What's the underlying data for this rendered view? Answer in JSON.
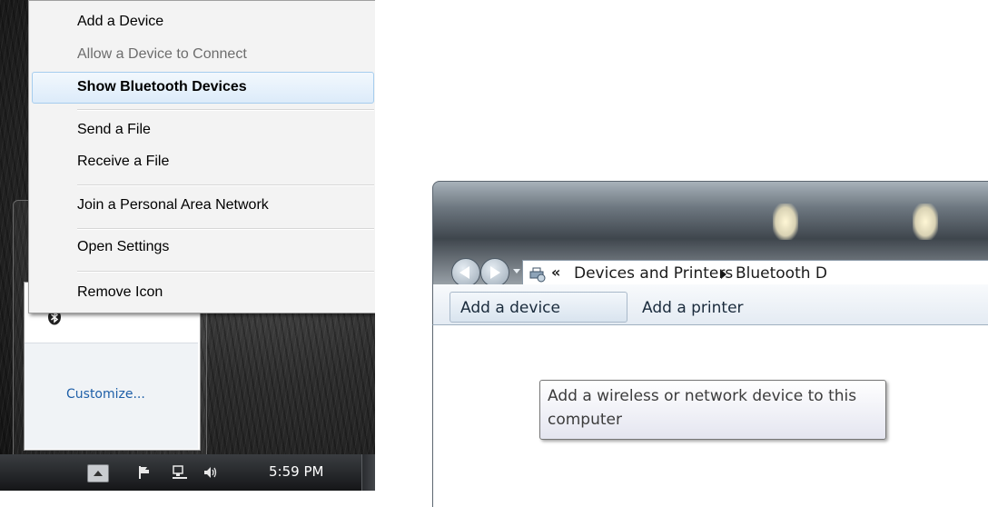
{
  "bluetooth_menu": {
    "items": [
      {
        "label": "Add a Device",
        "state": "normal"
      },
      {
        "label": "Allow a Device to Connect",
        "state": "disabled"
      },
      {
        "label": "Show Bluetooth Devices",
        "state": "highlighted"
      },
      {
        "label": "Send a File",
        "state": "normal"
      },
      {
        "label": "Receive a File",
        "state": "normal"
      },
      {
        "label": "Join a Personal Area Network",
        "state": "normal"
      },
      {
        "label": "Open Settings",
        "state": "normal"
      },
      {
        "label": "Remove Icon",
        "state": "normal"
      }
    ]
  },
  "tray_flyout": {
    "icon": "bluetooth-icon",
    "customize_label": "Customize..."
  },
  "taskbar": {
    "clock": "5:59 PM",
    "icons": [
      "show-hidden-icons-icon",
      "action-center-flag-icon",
      "network-icon",
      "volume-icon"
    ]
  },
  "explorer": {
    "breadcrumb": {
      "overflow": "«",
      "items": [
        "Devices and Printers",
        "Bluetooth D"
      ]
    },
    "toolbar": {
      "add_device_label": "Add a device",
      "add_printer_label": "Add a printer"
    },
    "tooltip": "Add a wireless or network device to this computer"
  },
  "colors": {
    "menu_highlight": "#dcebfa",
    "menu_highlight_border": "#a6cdee",
    "link": "#1e5fa8",
    "taskbar": "#151618"
  }
}
